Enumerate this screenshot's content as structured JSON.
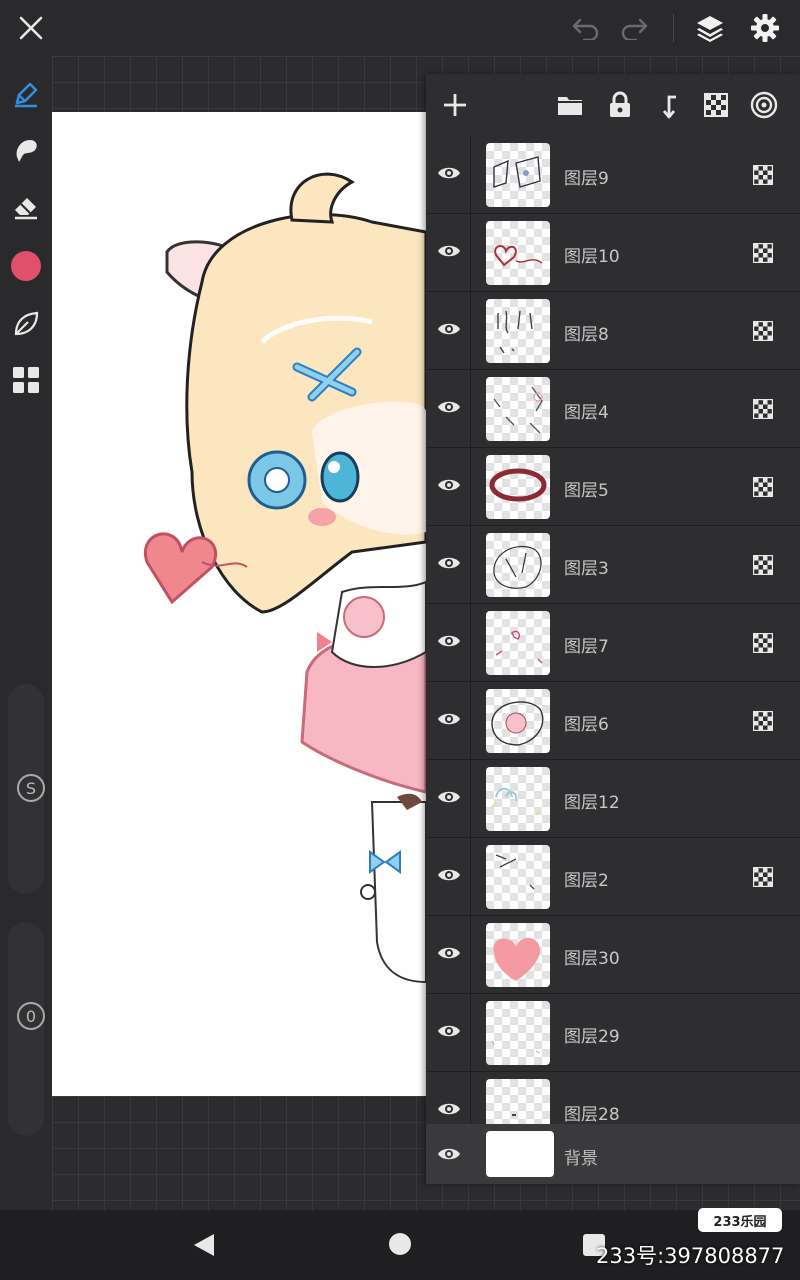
{
  "toolbar": {
    "close_icon": "close-icon",
    "undo_icon": "undo-icon",
    "redo_icon": "redo-icon",
    "layers_icon": "layers-icon",
    "settings_icon": "gear-icon"
  },
  "tools": {
    "pen": "pen-icon",
    "smudge": "smudge-icon",
    "eraser": "eraser-icon",
    "color": "#e05069",
    "leaf": "leaf-icon",
    "grid": "grid-icon",
    "size_slider_label": "S",
    "opacity_slider_label": "0"
  },
  "layer_panel": {
    "actions": [
      "add-layer",
      "folder",
      "lock",
      "merge-down",
      "alpha-lock",
      "target"
    ],
    "layers": [
      {
        "name": "图层9",
        "visible": true,
        "alpha_lock": true
      },
      {
        "name": "图层10",
        "visible": true,
        "alpha_lock": true
      },
      {
        "name": "图层8",
        "visible": true,
        "alpha_lock": true
      },
      {
        "name": "图层4",
        "visible": true,
        "alpha_lock": true
      },
      {
        "name": "图层5",
        "visible": true,
        "alpha_lock": true
      },
      {
        "name": "图层3",
        "visible": true,
        "alpha_lock": true
      },
      {
        "name": "图层7",
        "visible": true,
        "alpha_lock": true
      },
      {
        "name": "图层6",
        "visible": true,
        "alpha_lock": true
      },
      {
        "name": "图层12",
        "visible": true,
        "alpha_lock": false
      },
      {
        "name": "图层2",
        "visible": true,
        "alpha_lock": true
      },
      {
        "name": "图层30",
        "visible": true,
        "alpha_lock": false
      },
      {
        "name": "图层29",
        "visible": true,
        "alpha_lock": false
      },
      {
        "name": "图层28",
        "visible": true,
        "alpha_lock": false
      }
    ],
    "background": {
      "name": "背景",
      "visible": true
    }
  },
  "watermark": {
    "logo": "233乐园",
    "id_text": "233号:397808877"
  }
}
